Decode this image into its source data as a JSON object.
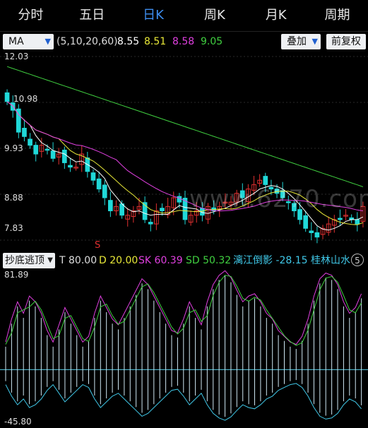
{
  "tabs": [
    {
      "label": "分时"
    },
    {
      "label": "五日"
    },
    {
      "label": "日K",
      "active": true
    },
    {
      "label": "周K"
    },
    {
      "label": "月K"
    },
    {
      "label": "周期"
    }
  ],
  "ma_bar": {
    "selector": "MA",
    "params": "(5,10,20,60)",
    "values": [
      "8.55",
      "8.51",
      "8.58",
      "9.05"
    ],
    "colors": [
      "#ffffff",
      "#e8e838",
      "#e040e0",
      "#40d040"
    ],
    "overlay_label": "叠加",
    "restore_label": "前复权"
  },
  "price_axis": {
    "labels": [
      "12.03",
      "10.98",
      "9.93",
      "8.88",
      "7.83"
    ],
    "grid": true
  },
  "signal_marker": "S",
  "watermark": "www.6270.com",
  "indicator_bar": {
    "selector": "抄底逃顶",
    "items": [
      {
        "label": "T",
        "value": "80.00",
        "color": "#dddddd"
      },
      {
        "label": "D",
        "value": "20.00",
        "color": "#e8e838"
      },
      {
        "label": "SK",
        "value": "60.39",
        "color": "#e040e0"
      },
      {
        "label": "SD",
        "value": "50.32",
        "color": "#40d040"
      },
      {
        "label": "漓江倒影",
        "value": "-28.15",
        "color": "#40c8e8"
      },
      {
        "label": "桂林山水",
        "value": "",
        "color": "#40c8e8"
      }
    ],
    "badge": "5"
  },
  "indicator_axis": {
    "top": "81.89",
    "bottom": "-45.80"
  },
  "colors": {
    "up": "#e03030",
    "down": "#20d8d8",
    "accent": "#3d8ef0"
  },
  "chart_data": [
    {
      "type": "candlestick",
      "yaxis_ticks": [
        12.03,
        10.98,
        9.93,
        8.88,
        7.83
      ],
      "ylim": [
        7.83,
        12.03
      ],
      "series": [
        {
          "name": "MA5",
          "value": 8.55
        },
        {
          "name": "MA10",
          "value": 8.51
        },
        {
          "name": "MA20",
          "value": 8.58
        },
        {
          "name": "MA60",
          "value": 9.05
        }
      ],
      "close_trend": [
        11.0,
        10.8,
        10.3,
        10.2,
        10.0,
        9.8,
        10.0,
        9.9,
        9.7,
        9.8,
        9.6,
        9.5,
        9.5,
        9.8,
        9.4,
        9.2,
        9.0,
        8.8,
        8.5,
        8.6,
        8.4,
        8.4,
        8.5,
        8.6,
        8.3,
        8.2,
        8.5,
        8.5,
        8.6,
        8.8,
        8.7,
        8.3,
        8.4,
        8.5,
        8.4,
        8.6,
        8.5,
        8.6,
        8.7,
        8.7,
        8.9,
        8.8,
        9.0,
        9.1,
        9.2,
        9.1,
        9.0,
        8.9,
        8.8,
        8.7,
        8.5,
        8.3,
        8.1,
        8.0,
        7.9,
        8.1,
        8.2,
        8.3,
        8.3,
        8.4,
        8.3,
        8.2,
        8.6
      ]
    },
    {
      "type": "line",
      "ylim": [
        -45.8,
        81.89
      ],
      "series": [
        {
          "name": "SK",
          "value": 60.39
        },
        {
          "name": "SD",
          "value": 50.32
        },
        {
          "name": "漓江倒影",
          "value": -28.15
        }
      ],
      "shape": [
        20,
        40,
        55,
        45,
        60,
        55,
        45,
        30,
        20,
        35,
        50,
        40,
        30,
        20,
        25,
        45,
        60,
        50,
        40,
        35,
        45,
        55,
        65,
        75,
        70,
        60,
        50,
        40,
        30,
        28,
        40,
        55,
        45,
        35,
        55,
        70,
        78,
        82,
        76,
        65,
        55,
        60,
        62,
        55,
        45,
        40,
        30,
        25,
        20,
        18,
        25,
        40,
        60,
        75,
        80,
        78,
        70,
        55,
        45,
        50,
        62
      ]
    }
  ]
}
